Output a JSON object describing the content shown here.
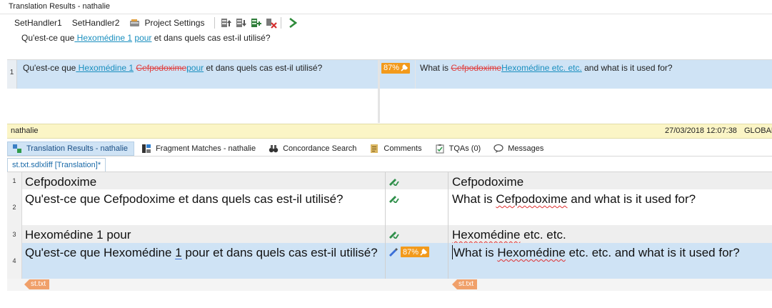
{
  "window": {
    "title": "Translation Results - nathalie"
  },
  "toolbar": {
    "set_handler1": "SetHandler1",
    "set_handler2": "SetHandler2",
    "project_settings": "Project Settings"
  },
  "source_preview": {
    "pre": "Qu'est-ce que",
    "link1": " Hexomédine 1",
    "mid": " ",
    "link2": "pour",
    "post": " et dans quels cas est-il utilisé?"
  },
  "compare": {
    "row_number": "1",
    "source": {
      "pre": "Qu'est-ce que",
      "link1": " Hexomédine 1",
      "sp": " ",
      "deleted": "Cefpodoxime",
      "link2": "pour",
      "post": " et dans quels cas est-il utilisé?"
    },
    "match_badge": "87%",
    "target": {
      "pre": "What is ",
      "deleted": "Cefpodoxime",
      "inserted": "Hexomédine etc. etc.",
      "post": " and what is it used for?"
    }
  },
  "userbar": {
    "user": "nathalie",
    "timestamp": "27/03/2018 12:07:38",
    "cutoff": "GLOBAL"
  },
  "tabs": [
    {
      "label": "Translation Results - nathalie"
    },
    {
      "label": "Fragment Matches - nathalie"
    },
    {
      "label": "Concordance Search"
    },
    {
      "label": "Comments"
    },
    {
      "label": "TQAs (0)"
    },
    {
      "label": "Messages"
    }
  ],
  "document_tab": {
    "label": "st.txt.sdlxliff [Translation]*"
  },
  "segments": [
    {
      "n": "1",
      "source": "Cefpodoxime",
      "target": "Cefpodoxime"
    },
    {
      "n": "2",
      "source": "Qu'est-ce que Cefpodoxime et dans quels cas est-il utilisé?",
      "target_pre": "What is ",
      "target_sp": "Cefpodoxime",
      "target_post": " and what is it used for?"
    },
    {
      "n": "3",
      "source": "Hexomédine 1 pour",
      "target_sp": "Hexomédine",
      "target_post": " etc. etc."
    },
    {
      "n": "4",
      "source_pre": "Qu'est-ce que Hexomédine ",
      "source_u": "1",
      "source_post": " pour et dans quels cas est-il utilisé?",
      "badge": "87%",
      "target_pre": "What is ",
      "target_sp": "Hexomédine",
      "target_post": " etc. etc. and what is it used for?"
    }
  ],
  "file_tags": {
    "source": "st.txt",
    "target": "st.txt"
  },
  "colors": {
    "accent": "#1a8fbf",
    "badge": "#f29a1c",
    "selected_row": "#cfe3f5",
    "userbar": "#fbf5c6",
    "deleted": "#e04040"
  }
}
